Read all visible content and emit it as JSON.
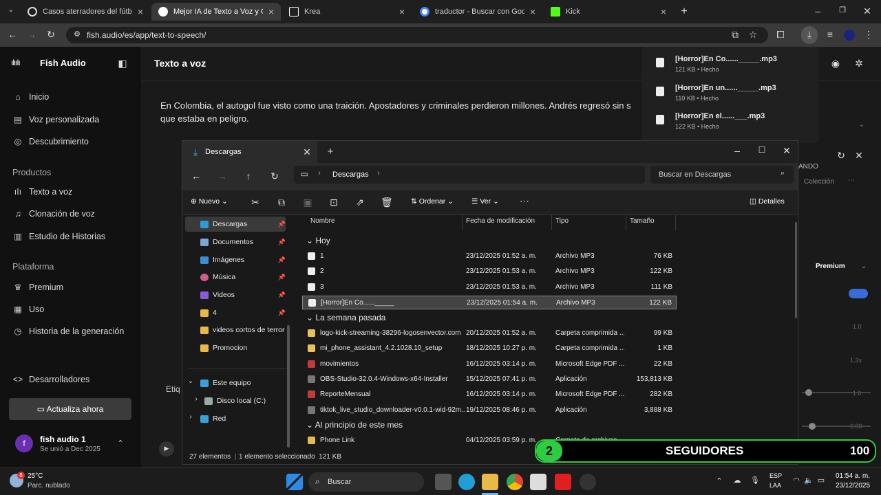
{
  "browser": {
    "tabs": [
      {
        "label": "Casos aterradores del fútbol",
        "color": "#dddddd"
      },
      {
        "label": "Mejor IA de Texto a Voz y Clona",
        "color": "#ffffff"
      },
      {
        "label": "Krea",
        "color": "#ffffff"
      },
      {
        "label": "traductor - Buscar con Google",
        "color": "#4285f4"
      },
      {
        "label": "Kick",
        "color": "#53fc18"
      }
    ],
    "url": "fish.audio/es/app/text-to-speech/"
  },
  "downloads_popup": {
    "items": [
      {
        "name": "[Horror]En Co......_____.mp3",
        "meta": "121 KB • Hecho"
      },
      {
        "name": "[Horror]En un......_____.mp3",
        "meta": "110 KB • Hecho"
      },
      {
        "name": "[Horror]En el......___.mp3",
        "meta": "122 KB • Hecho"
      }
    ]
  },
  "app": {
    "brand": "Fish Audio",
    "page_title": "Texto a voz",
    "nav_main": [
      "Inicio",
      "Voz personalizada",
      "Descubrimiento"
    ],
    "section_products": "Productos",
    "nav_products": [
      "Texto a voz",
      "Clonación de voz",
      "Estudio de Historias"
    ],
    "section_platform": "Plataforma",
    "nav_platform": [
      "Premium",
      "Uso",
      "Historia de la generación"
    ],
    "developers": "Desarrolladores",
    "upgrade": "Actualiza ahora",
    "user_name": "fish audio 1",
    "user_joined": "Se unió a Dec 2025",
    "user_initial": "f",
    "text_line1": "En Colombia, el autogol fue visto como una traición. Apostadores y criminales perdieron millones. Andrés regresó sin s",
    "text_line2": "que estaba en peligro.",
    "right_fragments": [
      "ANDO",
      "Colección",
      "Premium",
      "1.0",
      "1.3x",
      "1.0",
      "0.98"
    ],
    "left_fragment": "Etiq"
  },
  "explorer": {
    "tab_title": "Descargas",
    "breadcrumb": "Descargas",
    "search_placeholder": "Buscar en Descargas",
    "cmd": {
      "new": "Nuevo",
      "sort": "Ordenar",
      "view": "Ver",
      "details": "Detalles"
    },
    "tree": [
      {
        "label": "Descargas",
        "color": "#2e9bd8",
        "pinned": true
      },
      {
        "label": "Documentos",
        "color": "#7aa7d8",
        "pinned": true
      },
      {
        "label": "Imágenes",
        "color": "#3b8fd1",
        "pinned": true
      },
      {
        "label": "Música",
        "color": "#d05a8a",
        "pinned": true
      },
      {
        "label": "Videos",
        "color": "#8a5ad8",
        "pinned": true
      },
      {
        "label": "4",
        "color": "#e8b84a",
        "pinned": true
      },
      {
        "label": "videos cortos de terror",
        "color": "#e8b84a",
        "pinned": false
      },
      {
        "label": "Promocion",
        "color": "#e8b84a",
        "pinned": false
      }
    ],
    "tree_pc": [
      "Este equipo",
      "Disco local (C:)",
      "Red"
    ],
    "columns": [
      "Nombre",
      "Fecha de modificación",
      "Tipo",
      "Tamaño"
    ],
    "groups": [
      "Hoy",
      "La semana pasada",
      "Al principio de este mes"
    ],
    "rows_today": [
      {
        "name": "1",
        "date": "23/12/2025 01:52 a. m.",
        "type": "Archivo MP3",
        "size": "76 KB"
      },
      {
        "name": "2",
        "date": "23/12/2025 01:53 a. m.",
        "type": "Archivo MP3",
        "size": "122 KB"
      },
      {
        "name": "3",
        "date": "23/12/2025 01:53 a. m.",
        "type": "Archivo MP3",
        "size": "111 KB"
      },
      {
        "name": "[Horror]En Co......_____",
        "date": "23/12/2025 01:54 a. m.",
        "type": "Archivo MP3",
        "size": "122 KB"
      }
    ],
    "rows_week": [
      {
        "name": "logo-kick-streaming-38296-logosenvector.com",
        "date": "20/12/2025 01:52 a. m.",
        "type": "Carpeta comprimida ...",
        "size": "99 KB"
      },
      {
        "name": "mi_phone_assistant_4.2.1028.10_setup",
        "date": "18/12/2025 10:27 p. m.",
        "type": "Carpeta comprimida ...",
        "size": "1 KB"
      },
      {
        "name": "movimientos",
        "date": "16/12/2025 03:14 p. m.",
        "type": "Microsoft Edge PDF ...",
        "size": "22 KB"
      },
      {
        "name": "OBS-Studio-32.0.4-Windows-x64-Installer",
        "date": "15/12/2025 07:41 p. m.",
        "type": "Aplicación",
        "size": "153,813 KB"
      },
      {
        "name": "ReporteMensual",
        "date": "16/12/2025 03:14 p. m.",
        "type": "Microsoft Edge PDF ...",
        "size": "282 KB"
      },
      {
        "name": "tiktok_live_studio_downloader-v0.0.1-wid-92m...",
        "date": "19/12/2025 08:46 p. m.",
        "type": "Aplicación",
        "size": "3,888 KB"
      }
    ],
    "rows_month": [
      {
        "name": "Phone Link",
        "date": "04/12/2025 03:59 p. m.",
        "type": "Carpeta de archivos",
        "size": ""
      }
    ],
    "status_count": "27 elementos",
    "status_selected": "1 elemento seleccionado  121 KB"
  },
  "overlay": {
    "number": "2",
    "label": "SEGUIDORES",
    "count": "100"
  },
  "taskbar": {
    "weather_temp": "25°C",
    "weather_desc": "Parc. nublado",
    "weather_badge": "6",
    "search": "Buscar",
    "lang1": "ESP",
    "lang2": "LAA",
    "time": "01:54 a. m.",
    "date": "23/12/2025"
  },
  "colors": {
    "accent_green": "#2ecc40",
    "selected": "#444444"
  }
}
